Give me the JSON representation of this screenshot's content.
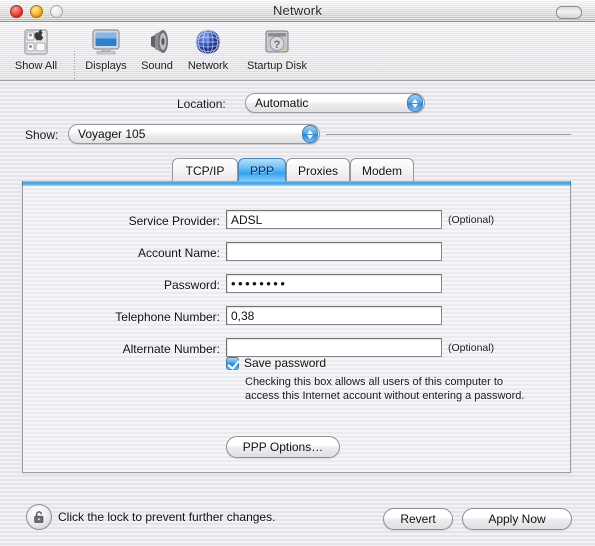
{
  "window": {
    "title": "Network",
    "controls": {
      "close": "close-button",
      "minimize": "minimize-button",
      "zoom": "zoom-button",
      "toolbar_toggle": "toolbar-toggle-button"
    }
  },
  "toolbar": {
    "items": [
      {
        "label": "Show All",
        "icon": "show-all-icon"
      },
      {
        "label": "Displays",
        "icon": "displays-icon"
      },
      {
        "label": "Sound",
        "icon": "sound-icon"
      },
      {
        "label": "Network",
        "icon": "network-globe-icon"
      },
      {
        "label": "Startup Disk",
        "icon": "startup-disk-icon"
      }
    ]
  },
  "selectors": {
    "location_label": "Location:",
    "location_value": "Automatic",
    "show_label": "Show:",
    "show_value": "Voyager 105"
  },
  "tabs": [
    {
      "label": "TCP/IP",
      "selected": false
    },
    {
      "label": "PPP",
      "selected": true
    },
    {
      "label": "Proxies",
      "selected": false
    },
    {
      "label": "Modem",
      "selected": false
    }
  ],
  "form": {
    "fields": [
      {
        "label": "Service Provider:",
        "value": "ADSL",
        "optional": "(Optional)",
        "masked": false
      },
      {
        "label": "Account Name:",
        "value": "",
        "optional": "",
        "masked": false
      },
      {
        "label": "Password:",
        "value": "••••••••",
        "optional": "",
        "masked": true
      },
      {
        "label": "Telephone Number:",
        "value": "0,38",
        "optional": "",
        "masked": false
      },
      {
        "label": "Alternate Number:",
        "value": "",
        "optional": "(Optional)",
        "masked": false
      }
    ],
    "save_password": {
      "label": "Save password",
      "checked": true,
      "help_line1": "Checking this box allows all users of this computer to",
      "help_line2": "access this Internet account without entering a password."
    },
    "ppp_options_button": "PPP Options…"
  },
  "bottom": {
    "lock_icon": "lock-open-icon",
    "lock_text": "Click the lock to prevent further changes.",
    "revert_button": "Revert",
    "apply_button": "Apply Now"
  },
  "colors": {
    "accent_blue": "#34a2f0",
    "panel_bg": "#f0f0f4",
    "window_bg": "#ececf0"
  }
}
